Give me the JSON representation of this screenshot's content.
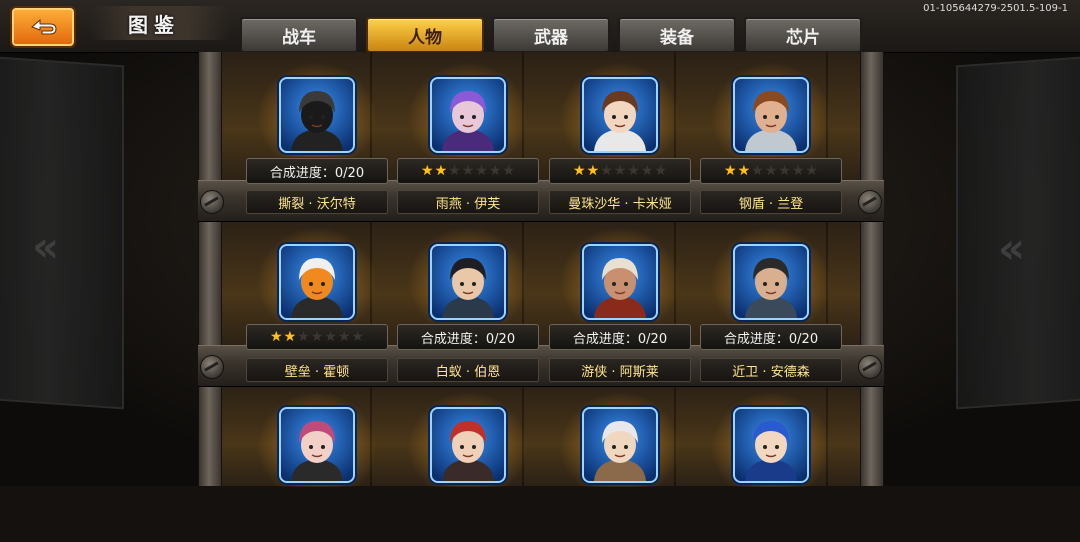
{
  "header": {
    "title": "图鉴",
    "version": "01-105644279-2501.5-109-1"
  },
  "tabs": [
    {
      "label": "战车",
      "active": false
    },
    {
      "label": "人物",
      "active": true
    },
    {
      "label": "武器",
      "active": false
    },
    {
      "label": "装备",
      "active": false
    },
    {
      "label": "芯片",
      "active": false
    }
  ],
  "characters": [
    {
      "name": "撕裂 · 沃尔特",
      "status": "合成进度：0/20",
      "stars": null,
      "icon": "hooded-figure-portrait"
    },
    {
      "name": "雨燕 · 伊芙",
      "status": null,
      "stars": {
        "filled": 2,
        "total": 7
      },
      "icon": "purple-hair-girl-portrait"
    },
    {
      "name": "曼珠沙华 · 卡米娅",
      "status": null,
      "stars": {
        "filled": 2,
        "total": 7
      },
      "icon": "brown-hair-woman-portrait"
    },
    {
      "name": "钢盾 · 兰登",
      "status": null,
      "stars": {
        "filled": 2,
        "total": 7
      },
      "icon": "bearded-man-portrait"
    },
    {
      "name": "壁垒 · 霍顿",
      "status": null,
      "stars": {
        "filled": 2,
        "total": 7
      },
      "icon": "tiger-mech-portrait"
    },
    {
      "name": "白蚁 · 伯恩",
      "status": "合成进度：0/20",
      "stars": null,
      "icon": "dark-hair-man-portrait"
    },
    {
      "name": "游侠 · 阿斯莱",
      "status": "合成进度：0/20",
      "stars": null,
      "icon": "cowboy-hat-portrait"
    },
    {
      "name": "近卫 · 安德森",
      "status": "合成进度：0/20",
      "stars": null,
      "icon": "headband-soldier-portrait"
    },
    {
      "name": "",
      "status": null,
      "stars": null,
      "icon": "pink-hair-eyepatch-portrait"
    },
    {
      "name": "",
      "status": null,
      "stars": null,
      "icon": "red-hair-goggles-portrait"
    },
    {
      "name": "",
      "status": null,
      "stars": null,
      "icon": "white-hair-portrait"
    },
    {
      "name": "",
      "status": null,
      "stars": null,
      "icon": "blue-hair-portrait"
    }
  ],
  "colors": {
    "accent": "#f0a020",
    "star": "#ffc21a",
    "portrait_frame": "#2a7be0"
  }
}
